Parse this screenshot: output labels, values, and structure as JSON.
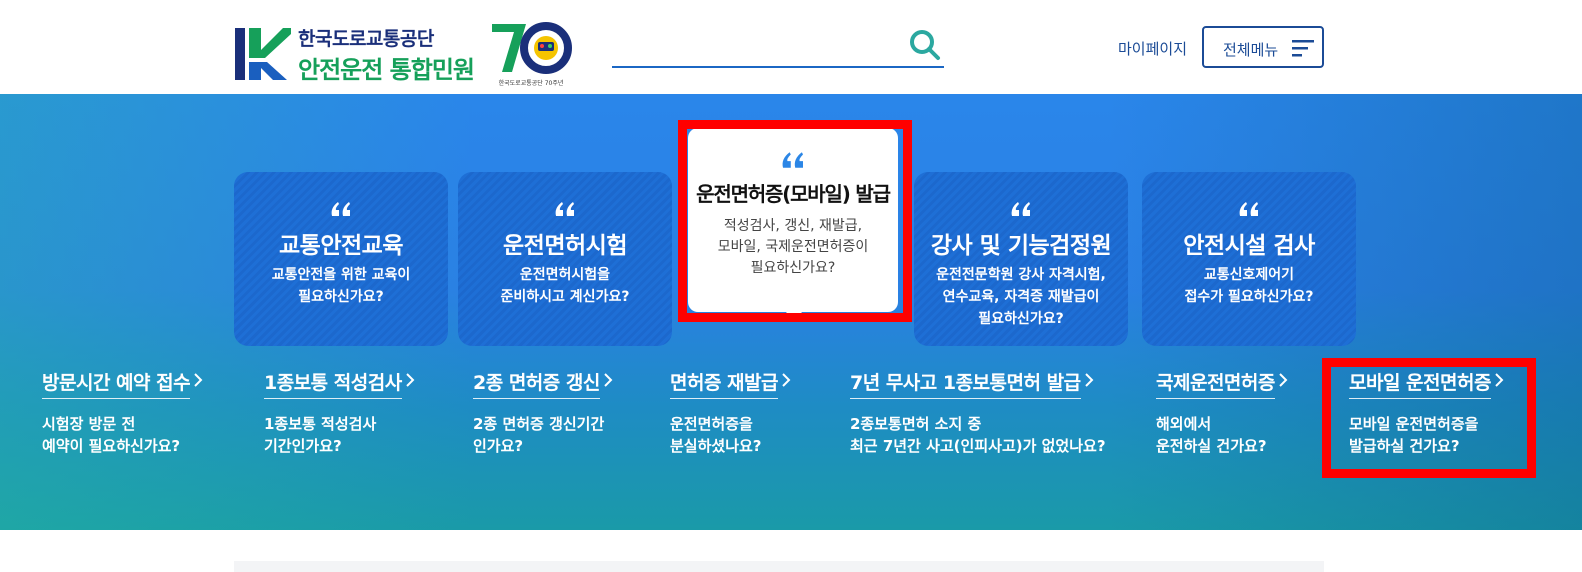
{
  "header": {
    "org_name": "한국도로교통공단",
    "service_name": "안전운전 통합민원",
    "anniversary_caption": "한국도로교통공단 70주년",
    "search_placeholder": "",
    "mypage_label": "마이페이지",
    "allmenu_label": "전체메뉴"
  },
  "cards": [
    {
      "title": "교통안전교육",
      "desc_line1": "교통안전을 위한 교육이",
      "desc_line2": "필요하신가요?",
      "desc_line3": ""
    },
    {
      "title": "운전면허시험",
      "desc_line1": "운전면허시험을",
      "desc_line2": "준비하시고 계신가요?",
      "desc_line3": ""
    },
    {
      "title": "운전면허증(모바일) 발급",
      "desc_line1": "적성검사, 갱신, 재발급,",
      "desc_line2": "모바일, 국제운전면허증이",
      "desc_line3": "필요하신가요?"
    },
    {
      "title": "강사 및 기능검정원",
      "desc_line1": "운전전문학원 강사 자격시험,",
      "desc_line2": "연수교육, 자격증 재발급이",
      "desc_line3": "필요하신가요?"
    },
    {
      "title": "안전시설 검사",
      "desc_line1": "교통신호제어기",
      "desc_line2": "접수가 필요하신가요?",
      "desc_line3": ""
    }
  ],
  "links": [
    {
      "title": "방문시간 예약 접수",
      "desc_line1": "시험장 방문 전",
      "desc_line2": "예약이 필요하신가요?"
    },
    {
      "title": "1종보통 적성검사",
      "desc_line1": "1종보통 적성검사",
      "desc_line2": "기간인가요?"
    },
    {
      "title": "2종 면허증 갱신",
      "desc_line1": "2종 면허증 갱신기간",
      "desc_line2": "인가요?"
    },
    {
      "title": "면허증 재발급",
      "desc_line1": "운전면허증을",
      "desc_line2": "분실하셨나요?"
    },
    {
      "title": "7년 무사고 1종보통면허 발급",
      "desc_line1": "2종보통면허 소지 중",
      "desc_line2": "최근 7년간 사고(인피사고)가 없었나요?"
    },
    {
      "title": "국제운전면허증",
      "desc_line1": "해외에서",
      "desc_line2": "운전하실 건가요?"
    },
    {
      "title": "모바일 운전면허증",
      "desc_line1": "모바일 운전면허증을",
      "desc_line2": "발급하실 건가요?"
    }
  ],
  "colors": {
    "brand_navy": "#1a2f7a",
    "brand_green": "#16a05a",
    "card_blue": "#1e6fd6",
    "highlight": "#ff0000"
  },
  "icons": {
    "search": "search-icon",
    "menu": "hamburger-menu-icon",
    "quote": "quote-icon",
    "chevron": "chevron-right-icon"
  }
}
